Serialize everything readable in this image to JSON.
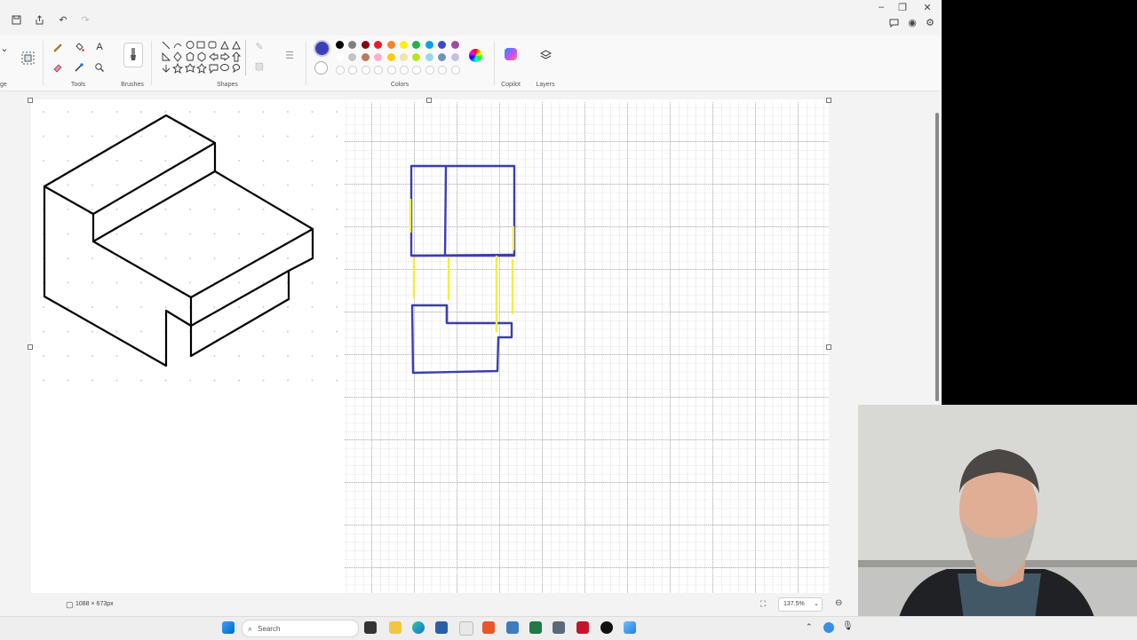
{
  "ribbon": {
    "tools_label": "Tools",
    "brushes_label": "Brushes",
    "shapes_label": "Shapes",
    "colors_label": "Colors",
    "copilot_label": "Copilot",
    "layers_label": "Layers",
    "left_cut_label": "ge",
    "primary_color": "#3b3fb7",
    "palette_row1": [
      "#000000",
      "#7f7f7f",
      "#880015",
      "#ed1c24",
      "#ff7f27",
      "#fff200",
      "#22b14c",
      "#00a2e8",
      "#3f48cc",
      "#a349a4"
    ],
    "palette_row2": [
      "#ffffff",
      "#c3c3c3",
      "#b97a57",
      "#ffaec9",
      "#ffc90e",
      "#efe4b0",
      "#b5e61d",
      "#99d9ea",
      "#7092be",
      "#c8bfe7"
    ]
  },
  "status": {
    "canvas_size": "1088 × 673px",
    "zoom": "137.5%"
  },
  "taskbar": {
    "search_placeholder": "Search"
  },
  "drawing": {
    "stroke_blue": "#3a3fae",
    "stroke_yellow": "#f5ee3a"
  }
}
